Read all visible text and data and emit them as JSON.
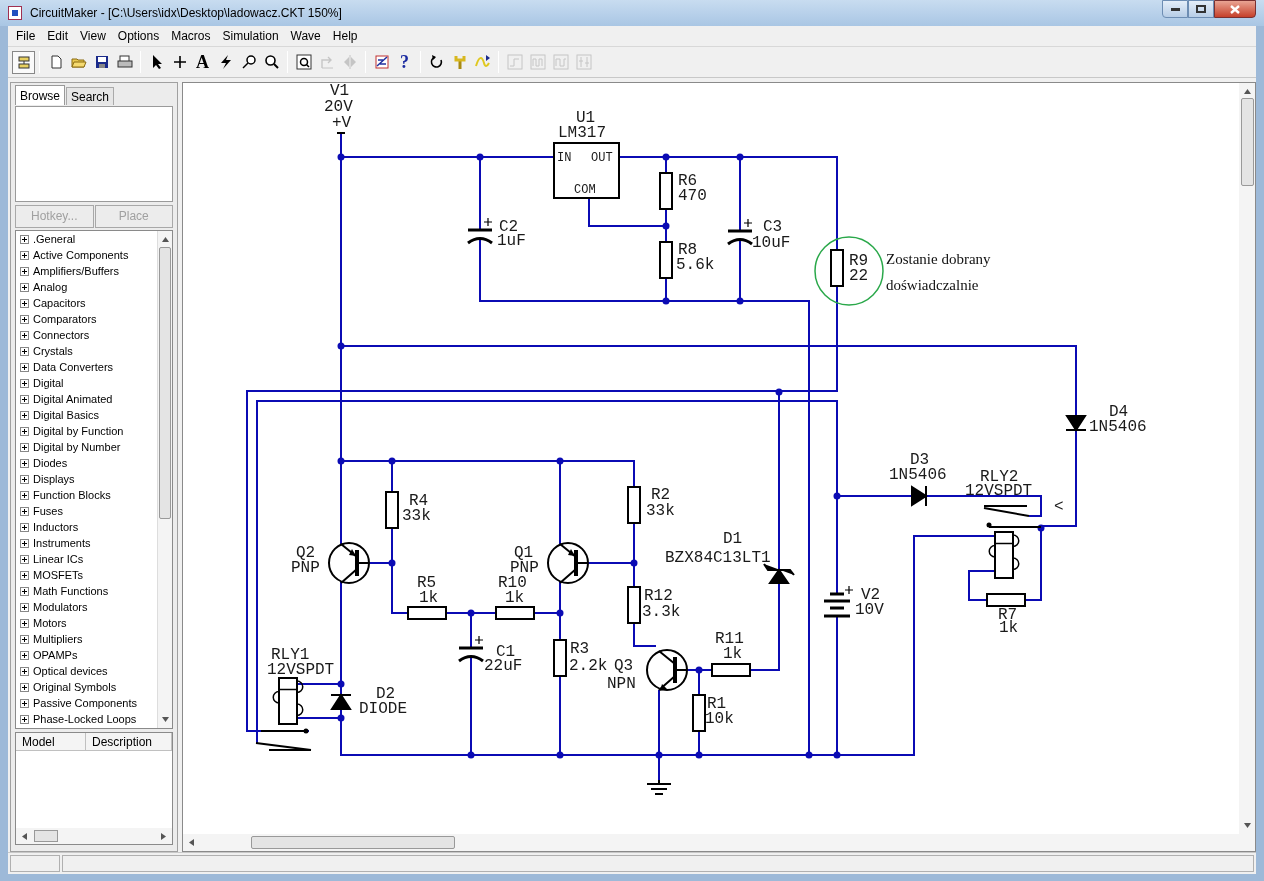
{
  "window": {
    "title": "CircuitMaker - [C:\\Users\\idx\\Desktop\\ladowacz.CKT 150%]"
  },
  "menu": [
    "File",
    "Edit",
    "View",
    "Options",
    "Macros",
    "Simulation",
    "Wave",
    "Help"
  ],
  "toolbar": [
    [
      {
        "disabled": false
      }
    ],
    [
      {
        "disabled": false
      },
      {
        "disabled": false
      },
      {
        "disabled": false
      },
      {
        "disabled": false
      }
    ],
    [
      {
        "disabled": false
      },
      {
        "disabled": false
      },
      {
        "text": "A",
        "disabled": false
      },
      {
        "disabled": false
      },
      {
        "disabled": false
      },
      {
        "disabled": false
      }
    ],
    [
      {
        "disabled": false
      },
      {
        "disabled": true
      },
      {
        "disabled": true
      }
    ],
    [
      {
        "disabled": false
      },
      {
        "text": "?",
        "disabled": false
      }
    ],
    [
      {
        "disabled": false
      },
      {
        "disabled": false
      },
      {
        "disabled": false
      }
    ],
    [
      {
        "disabled": true
      },
      {
        "disabled": true
      },
      {
        "disabled": true
      },
      {
        "disabled": true
      }
    ]
  ],
  "browser": {
    "tabs": [
      {
        "label": "Browse",
        "selected": true
      },
      {
        "label": "Search",
        "selected": false
      }
    ],
    "buttons": [
      {
        "label": "Hotkey...",
        "disabled": true
      },
      {
        "label": "Place",
        "disabled": true
      }
    ],
    "categories": [
      {
        "label": ".General",
        "expanded": false
      },
      {
        "label": "Active Components",
        "expanded": false
      },
      {
        "label": "Amplifiers/Buffers",
        "expanded": false
      },
      {
        "label": "Analog",
        "expanded": false
      },
      {
        "label": "Capacitors",
        "expanded": false
      },
      {
        "label": "Comparators",
        "expanded": false
      },
      {
        "label": "Connectors",
        "expanded": false
      },
      {
        "label": "Crystals",
        "expanded": false
      },
      {
        "label": "Data Converters",
        "expanded": false
      },
      {
        "label": "Digital",
        "expanded": false
      },
      {
        "label": "Digital Animated",
        "expanded": false
      },
      {
        "label": "Digital Basics",
        "expanded": false
      },
      {
        "label": "Digital by Function",
        "expanded": false
      },
      {
        "label": "Digital by Number",
        "expanded": false
      },
      {
        "label": "Diodes",
        "expanded": false
      },
      {
        "label": "Displays",
        "expanded": false
      },
      {
        "label": "Function Blocks",
        "expanded": false
      },
      {
        "label": "Fuses",
        "expanded": false
      },
      {
        "label": "Inductors",
        "expanded": false
      },
      {
        "label": "Instruments",
        "expanded": false
      },
      {
        "label": "Linear ICs",
        "expanded": false
      },
      {
        "label": "MOSFETs",
        "expanded": false
      },
      {
        "label": "Math Functions",
        "expanded": false
      },
      {
        "label": "Modulators",
        "expanded": false
      },
      {
        "label": "Motors",
        "expanded": false
      },
      {
        "label": "Multipliers",
        "expanded": false
      },
      {
        "label": "OPAMPs",
        "expanded": false
      },
      {
        "label": "Optical devices",
        "expanded": false
      },
      {
        "label": "Original Symbols",
        "expanded": false
      },
      {
        "label": "Passive Components",
        "expanded": false
      },
      {
        "label": "Phase-Locked Loops",
        "expanded": false
      }
    ],
    "columns": [
      "Model",
      "Description"
    ]
  },
  "schematic": {
    "components": [
      {
        "kind": "supply",
        "ref": "V1",
        "value": "20V",
        "terminal": "+V"
      },
      {
        "kind": "regulator",
        "ref": "U1",
        "value": "LM317",
        "pins": [
          "IN",
          "OUT",
          "COM"
        ]
      },
      {
        "kind": "capacitor",
        "ref": "C2",
        "value": "1uF"
      },
      {
        "kind": "resistor",
        "ref": "R6",
        "value": "470"
      },
      {
        "kind": "resistor",
        "ref": "R8",
        "value": "5.6k"
      },
      {
        "kind": "capacitor",
        "ref": "C3",
        "value": "10uF"
      },
      {
        "kind": "resistor",
        "ref": "R9",
        "value": "22"
      },
      {
        "kind": "diode",
        "ref": "D4",
        "value": "1N5406"
      },
      {
        "kind": "diode",
        "ref": "D3",
        "value": "1N5406"
      },
      {
        "kind": "relay",
        "ref": "RLY2",
        "value": "12VSPDT",
        "marker": "<"
      },
      {
        "kind": "resistor",
        "ref": "R4",
        "value": "33k"
      },
      {
        "kind": "pnp",
        "ref": "Q2",
        "value": "PNP"
      },
      {
        "kind": "resistor",
        "ref": "R2",
        "value": "33k"
      },
      {
        "kind": "pnp",
        "ref": "Q1",
        "value": "PNP"
      },
      {
        "kind": "zener",
        "ref": "D1",
        "value": "BZX84C13LT1"
      },
      {
        "kind": "resistor",
        "ref": "R5",
        "value": "1k"
      },
      {
        "kind": "resistor",
        "ref": "R10",
        "value": "1k"
      },
      {
        "kind": "resistor",
        "ref": "R12",
        "value": "3.3k"
      },
      {
        "kind": "battery",
        "ref": "V2",
        "value": "10V"
      },
      {
        "kind": "resistor",
        "ref": "R7",
        "value": "1k"
      },
      {
        "kind": "relay",
        "ref": "RLY1",
        "value": "12VSPDT"
      },
      {
        "kind": "capacitor",
        "ref": "C1",
        "value": "22uF"
      },
      {
        "kind": "resistor",
        "ref": "R3",
        "value": "2.2k"
      },
      {
        "kind": "npn",
        "ref": "Q3",
        "value": "NPN"
      },
      {
        "kind": "resistor",
        "ref": "R11",
        "value": "1k"
      },
      {
        "kind": "diode",
        "ref": "D2",
        "value": "DIODE"
      },
      {
        "kind": "resistor",
        "ref": "R1",
        "value": "10k"
      }
    ],
    "note": [
      "Zostanie dobrany",
      "doświadczalnie"
    ]
  }
}
